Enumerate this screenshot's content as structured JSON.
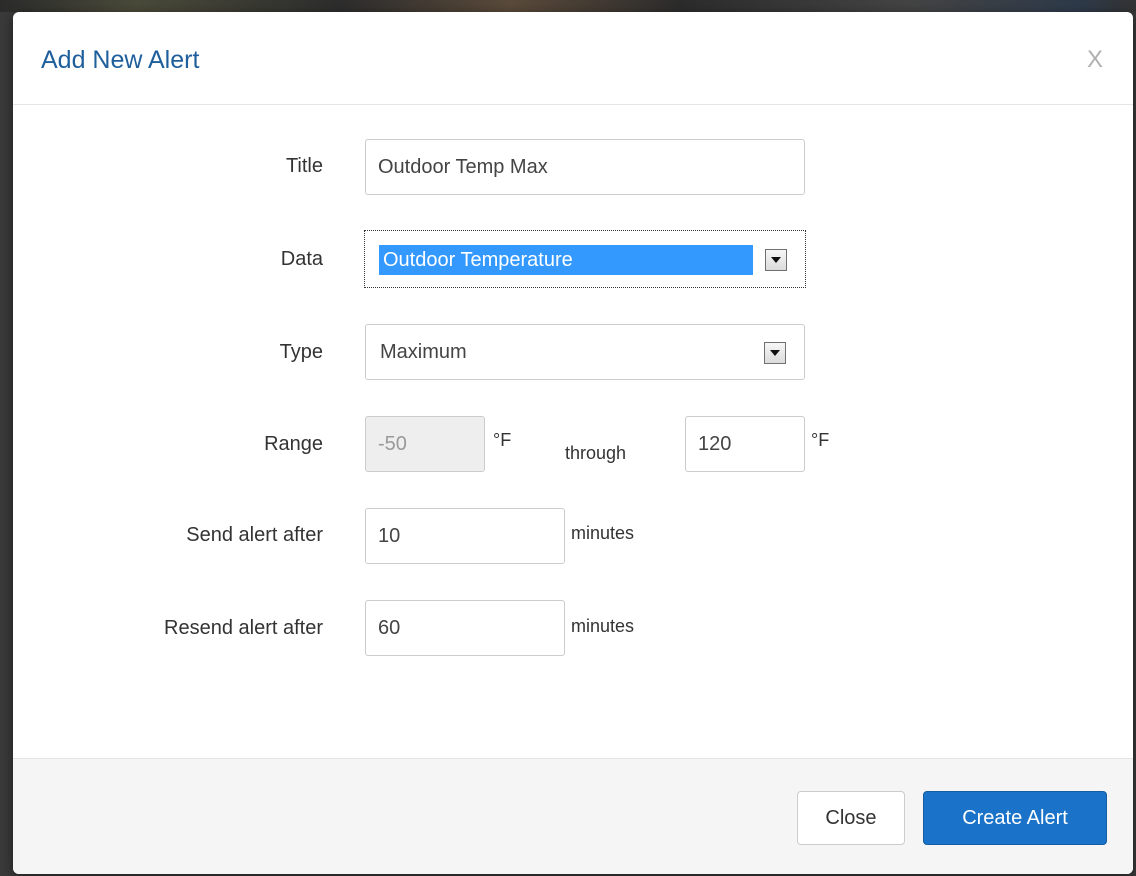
{
  "modal": {
    "title": "Add New Alert",
    "close_x": "X"
  },
  "form": {
    "title": {
      "label": "Title",
      "value": "Outdoor Temp Max"
    },
    "data": {
      "label": "Data",
      "selected": "Outdoor Temperature"
    },
    "type": {
      "label": "Type",
      "selected": "Maximum"
    },
    "range": {
      "label": "Range",
      "min_value": "-50",
      "min_unit": "°F",
      "through": "through",
      "max_value": "120",
      "max_unit": "°F"
    },
    "send_after": {
      "label": "Send alert after",
      "value": "10",
      "unit": "minutes"
    },
    "resend_after": {
      "label": "Resend alert after",
      "value": "60",
      "unit": "minutes"
    }
  },
  "footer": {
    "close_label": "Close",
    "create_label": "Create Alert"
  },
  "colors": {
    "title": "#1f5f9c",
    "primary_button": "#1a73c8",
    "selection_highlight": "#3399ff"
  }
}
